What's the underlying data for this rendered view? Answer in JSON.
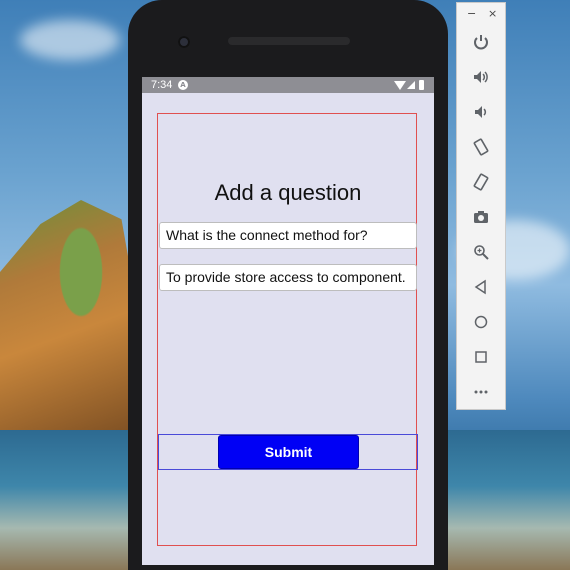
{
  "status_bar": {
    "time": "7:34",
    "app_icon": "A"
  },
  "app": {
    "title": "Add a question",
    "question_value": "What is the connect method for?",
    "answer_value": "To provide store access to component.",
    "submit_label": "Submit"
  },
  "emulator_toolbar": {
    "minimize_label": "−",
    "close_label": "×",
    "buttons": [
      {
        "icon": "power-icon"
      },
      {
        "icon": "volume-up-icon"
      },
      {
        "icon": "volume-down-icon"
      },
      {
        "icon": "rotate-left-icon"
      },
      {
        "icon": "rotate-right-icon"
      },
      {
        "icon": "camera-icon"
      },
      {
        "icon": "zoom-icon"
      },
      {
        "icon": "back-icon"
      },
      {
        "icon": "home-icon"
      },
      {
        "icon": "overview-icon"
      },
      {
        "icon": "more-icon"
      }
    ]
  },
  "colors": {
    "screen_bg": "#e0e0f0",
    "submit_bg": "#0000f5",
    "content_border": "#e05050",
    "button_row_border": "#4a4ad8"
  }
}
